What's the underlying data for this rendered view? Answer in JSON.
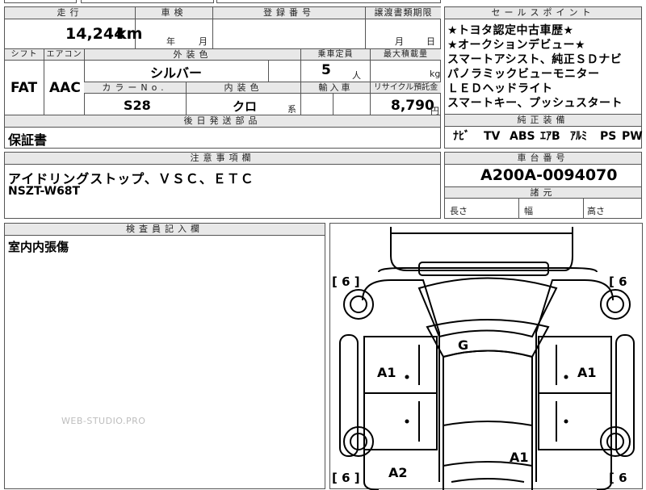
{
  "sheet": {
    "mileage": {
      "label": "走行",
      "value": "14,244",
      "unit": "km"
    },
    "shaken": {
      "label": "車検",
      "year_unit": "年",
      "month_unit": "月"
    },
    "registration": {
      "label": "登録番号"
    },
    "transfer_deadline": {
      "label": "譲渡書類期限",
      "month_unit": "月",
      "day_unit": "日"
    },
    "shift": {
      "label": "シフト",
      "value": "FAT"
    },
    "aircon": {
      "label": "エアコン",
      "value": "AAC"
    },
    "exterior_color": {
      "label": "外装色",
      "value": "シルバー"
    },
    "capacity": {
      "label": "乗車定員",
      "value": "5",
      "unit": "人"
    },
    "max_load": {
      "label": "最大積載量",
      "unit": "kg"
    },
    "color_no": {
      "label": "カラーNo.",
      "value": "S28"
    },
    "interior_color": {
      "label": "内装色",
      "value": "クロ",
      "suffix": "系"
    },
    "import": {
      "label": "輸入車"
    },
    "recycle": {
      "label": "リサイクル預託金",
      "value": "8,790",
      "unit": "円"
    },
    "later_parts": {
      "label": "後日発送部品",
      "value": "保証書"
    },
    "notes": {
      "label": "注意事項欄",
      "line1": "アイドリングストップ、ＶＳＣ、ＥＴＣ",
      "line2": "NSZT-W68T"
    },
    "inspector": {
      "label": "検査員記入欄",
      "value": "室内内張傷"
    },
    "sales_points": {
      "label": "セールスポイント",
      "items": [
        "★トヨタ認定中古車歴★",
        "★オークションデビュー★",
        "スマートアシスト、純正ＳＤナビ",
        "パノラミックビューモニター",
        "ＬＥＤヘッドライト",
        "スマートキー、プッシュスタート"
      ]
    },
    "equipment": {
      "label": "純正装備",
      "items": [
        "ﾅﾋﾞ",
        "TV",
        "ABS",
        "ｴｱB",
        "ｱﾙﾐ",
        "PS",
        "PW"
      ]
    },
    "chassis": {
      "label": "車台番号",
      "value": "A200A-0094070"
    },
    "dimensions": {
      "label": "諸元",
      "length": "長さ",
      "width": "幅",
      "height": "高さ"
    },
    "diagram": {
      "marks": {
        "g": "G",
        "a1_left": "A1",
        "a1_right": "A1",
        "a1_bottom": "A1",
        "a2": "A2"
      },
      "brackets": {
        "tl": "[ 6 ]",
        "tr": "[ 6",
        "bl": "[ 6 ]",
        "br": "[ 6"
      }
    },
    "watermark": "WEB-STUDIO.PRO"
  }
}
